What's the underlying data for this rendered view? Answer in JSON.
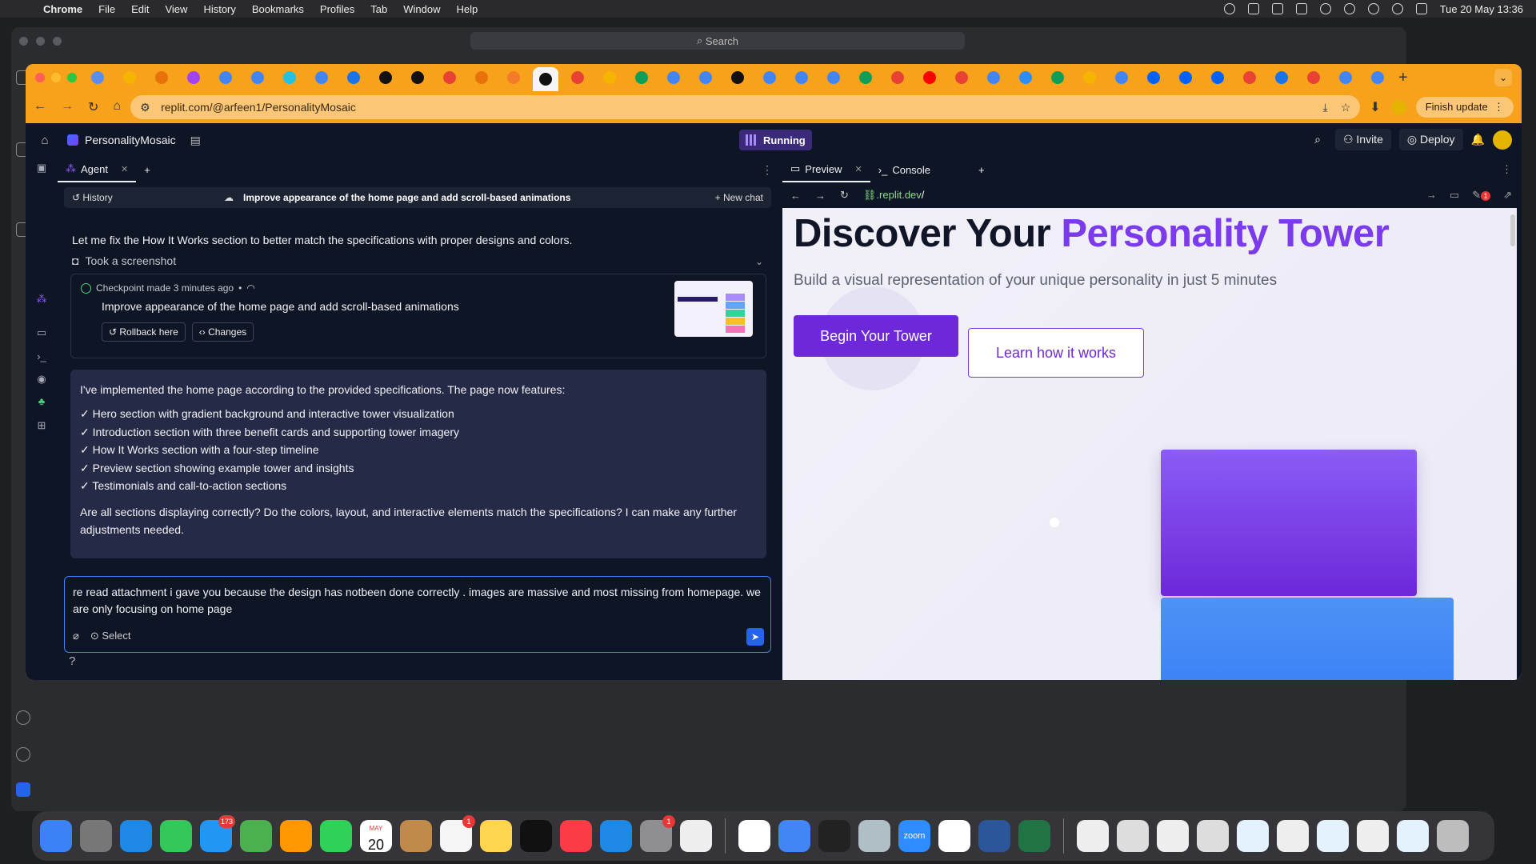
{
  "menubar": {
    "app": "Chrome",
    "items": [
      "File",
      "Edit",
      "View",
      "History",
      "Bookmarks",
      "Profiles",
      "Tab",
      "Window",
      "Help"
    ],
    "clock": "Tue 20 May  13:36"
  },
  "bgwindow": {
    "search": "Search"
  },
  "browser": {
    "url": "replit.com/@arfeen1/PersonalityMosaic",
    "finish_update": "Finish update",
    "tab_colors": [
      "#5b8def",
      "#f4b400",
      "#e8710a",
      "#a142f4",
      "#4285f4",
      "#4285f4",
      "#24c1e0",
      "#4285f4",
      "#1a73e8",
      "#111111",
      "#111111",
      "#e94235",
      "#e8710a",
      "#f47b2a",
      "#111111",
      "#e94235",
      "#f4b400",
      "#0f9d58",
      "#4285f4",
      "#4285f4",
      "#111111",
      "#4285f4",
      "#4285f4",
      "#4285f4",
      "#0f9d58",
      "#e94235",
      "#ff0000",
      "#e94235",
      "#4285f4",
      "#2d8cff",
      "#0f9d58",
      "#f4b400",
      "#4285f4",
      "#0061ff",
      "#0061ff",
      "#0061ff",
      "#ea4335",
      "#1a73e8",
      "#e94235",
      "#4285f4",
      "#4285f4"
    ]
  },
  "replit": {
    "project": "PersonalityMosaic",
    "status": "Running",
    "invite": "Invite",
    "deploy": "Deploy"
  },
  "agent": {
    "tab": "Agent",
    "history": "History",
    "chat_title": "Improve appearance of the home page and add scroll-based animations",
    "new_chat": "New chat",
    "message1": "Let me fix the How It Works section to better match the specifications with proper designs and colors.",
    "screenshot": "Took a screenshot",
    "checkpoint": {
      "meta": "Checkpoint made 3 minutes ago",
      "title": "Improve appearance of the home page and add scroll-based animations",
      "rollback": "Rollback here",
      "changes": "Changes"
    },
    "summary": {
      "intro": "I've implemented the home page according to the provided specifications. The page now features:",
      "items": [
        "✓ Hero section with gradient background and interactive tower visualization",
        "✓ Introduction section with three benefit cards and supporting tower imagery",
        "✓ How It Works section with a four-step timeline",
        "✓ Preview section showing example tower and insights",
        "✓ Testimonials and call-to-action sections"
      ],
      "question": "Are all sections displaying correctly? Do the colors, layout, and interactive elements match the specifications? I can make any further adjustments needed."
    },
    "input": "re read attachment i gave you because the design has notbeen done correctly . images are massive and most missing from homepage. we are only focusing on home page",
    "select": "Select"
  },
  "preview": {
    "tab_preview": "Preview",
    "tab_console": "Console",
    "url_host": ".replit.dev",
    "url_path": "/",
    "notif_count": "1",
    "site": {
      "title_a": "Discover Your ",
      "title_b": "Personality Tower",
      "subtitle": "Build a visual representation of your unique personality in just 5 minutes",
      "primary_cta": "Begin Your Tower",
      "secondary_cta": "Learn how it works"
    }
  },
  "dock": {
    "apps": [
      {
        "name": "finder",
        "color": "#3b82f6"
      },
      {
        "name": "launchpad",
        "color": "#777"
      },
      {
        "name": "safari",
        "color": "#1e88e5"
      },
      {
        "name": "messages",
        "color": "#34c759"
      },
      {
        "name": "mail",
        "color": "#2196f3",
        "badge": "173"
      },
      {
        "name": "maps",
        "color": "#4caf50"
      },
      {
        "name": "photos",
        "color": "#ff9800"
      },
      {
        "name": "facetime",
        "color": "#30d158"
      },
      {
        "name": "calendar",
        "color": "#ffffff",
        "label": "20"
      },
      {
        "name": "contacts",
        "color": "#c08a4a"
      },
      {
        "name": "reminders",
        "color": "#f5f5f5",
        "badge": "1"
      },
      {
        "name": "notes",
        "color": "#ffd54f"
      },
      {
        "name": "tv",
        "color": "#111111"
      },
      {
        "name": "music",
        "color": "#fc3c44"
      },
      {
        "name": "appstore",
        "color": "#1e88e5"
      },
      {
        "name": "settings",
        "color": "#8e8e93",
        "badge": "1"
      },
      {
        "name": "unknown",
        "color": "#eeeeee"
      },
      {
        "name": "vscode",
        "color": "#ffffff"
      },
      {
        "name": "chrome",
        "color": "#4285f4"
      },
      {
        "name": "terminal",
        "color": "#222222"
      },
      {
        "name": "utility",
        "color": "#b0bec5"
      },
      {
        "name": "zoom",
        "color": "#2d8cff",
        "label": "zoom"
      },
      {
        "name": "chatgpt",
        "color": "#ffffff"
      },
      {
        "name": "word",
        "color": "#2b579a"
      },
      {
        "name": "excel",
        "color": "#217346"
      },
      {
        "name": "doc1",
        "color": "#eeeeee"
      },
      {
        "name": "doc2",
        "color": "#dddddd"
      },
      {
        "name": "doc3",
        "color": "#eeeeee"
      },
      {
        "name": "doc4",
        "color": "#dddddd"
      },
      {
        "name": "doc5",
        "color": "#e3f2fd"
      },
      {
        "name": "doc6",
        "color": "#eeeeee"
      },
      {
        "name": "doc7",
        "color": "#e3f2fd"
      },
      {
        "name": "doc8",
        "color": "#eeeeee"
      },
      {
        "name": "doc9",
        "color": "#e3f2fd"
      },
      {
        "name": "trash",
        "color": "#bdbdbd"
      }
    ],
    "calendar_month": "MAY"
  }
}
